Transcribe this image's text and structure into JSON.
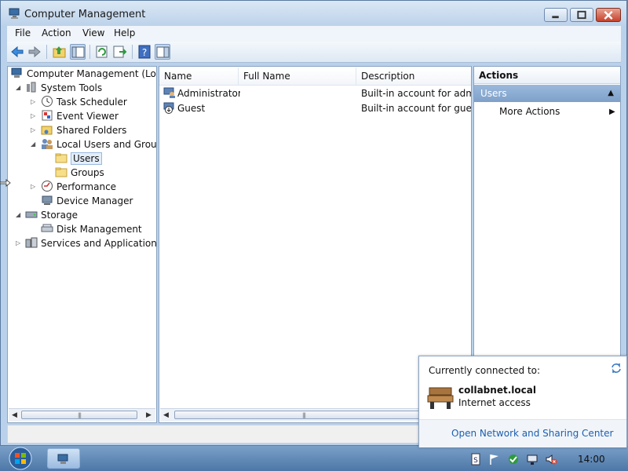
{
  "window": {
    "title": "Computer Management"
  },
  "menu": {
    "file": "File",
    "action": "Action",
    "view": "View",
    "help": "Help"
  },
  "toolbar": {
    "icons": [
      "back-arrow-icon",
      "forward-arrow-icon",
      "up-folder-icon",
      "show-hide-tree-icon",
      "refresh-icon",
      "export-list-icon",
      "help-icon",
      "show-hide-action-pane-icon"
    ]
  },
  "tree": {
    "root": "Computer Management (Local",
    "system_tools": "System Tools",
    "task_scheduler": "Task Scheduler",
    "event_viewer": "Event Viewer",
    "shared_folders": "Shared Folders",
    "local_users_groups": "Local Users and Groups",
    "users": "Users",
    "groups": "Groups",
    "performance": "Performance",
    "device_manager": "Device Manager",
    "storage": "Storage",
    "disk_management": "Disk Management",
    "services_apps": "Services and Applications"
  },
  "list": {
    "columns": {
      "name": "Name",
      "full_name": "Full Name",
      "description": "Description"
    },
    "rows": [
      {
        "name": "Administrator",
        "full_name": "",
        "description": "Built-in account for admir"
      },
      {
        "name": "Guest",
        "full_name": "",
        "description": "Built-in account for guest"
      }
    ]
  },
  "actions": {
    "title": "Actions",
    "section": "Users",
    "more_actions": "More Actions"
  },
  "network_popup": {
    "heading": "Currently connected to:",
    "network_name": "collabnet.local",
    "status": "Internet access",
    "link": "Open Network and Sharing Center"
  },
  "taskbar": {
    "clock": "14:00"
  },
  "colors": {
    "selection": "#e3eefa",
    "section_header": "#7ea0c9",
    "link": "#1c5fae"
  }
}
